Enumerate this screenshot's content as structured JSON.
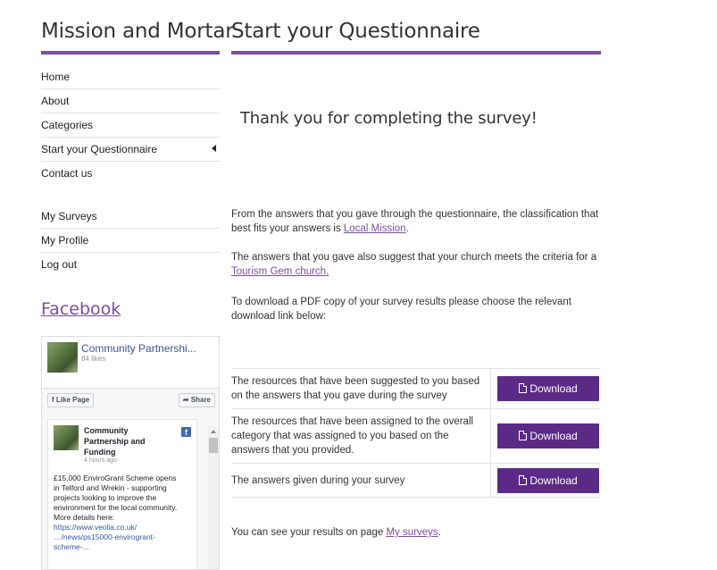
{
  "site": {
    "title": "Mission and Mortar"
  },
  "nav": {
    "primary": [
      {
        "label": "Home"
      },
      {
        "label": "About"
      },
      {
        "label": "Categories"
      },
      {
        "label": "Start your Questionnaire"
      },
      {
        "label": "Contact us"
      }
    ],
    "account": [
      {
        "label": "My Surveys"
      },
      {
        "label": "My Profile"
      },
      {
        "label": "Log out"
      }
    ]
  },
  "facebook": {
    "heading": "Facebook",
    "page_name": "Community Partnershi...",
    "likes": "84 likes",
    "like_label": "Like Page",
    "share_label": "Share",
    "post": {
      "author_line1": "Community",
      "author_line2": "Partnership and",
      "author_line3": "Funding",
      "time": "4 hours ago",
      "text1": "£15,000 EnviroGrant Scheme opens",
      "text2": "in Telford and Wrekin - supporting",
      "text3": "projects looking to improve the",
      "text4": "environment for the local community.",
      "text5": "More details here:",
      "link1": "https://www.veolia.co.uk/",
      "link2": "…/news/ps15000-envirogrant-",
      "link3": "scheme-..."
    }
  },
  "main": {
    "title": "Start your Questionnaire",
    "thanks": "Thank you for completing the survey!",
    "p1_text": "From the answers that you gave through the questionnaire, the classification that best fits your answers is ",
    "p1_link": "Local Mission",
    "p1_end": ".",
    "p2_text": "The answers that you gave also suggest that your church meets the criteria for a ",
    "p2_link": "Tourism Gem church.",
    "p3_text": "To download a PDF copy of your survey results please choose the relevant download link below:",
    "downloads": [
      {
        "description": "The resources that have been suggested to you based on the answers that you gave during the survey",
        "button": "Download"
      },
      {
        "description": "The resources that have been assigned to the overall category that was assigned to you based on the answers that you provided.",
        "button": "Download"
      },
      {
        "description": "The answers given during your survey",
        "button": "Download"
      }
    ],
    "footer_text": "You can see your results on page ",
    "footer_link": "My surveys",
    "footer_end": "."
  }
}
